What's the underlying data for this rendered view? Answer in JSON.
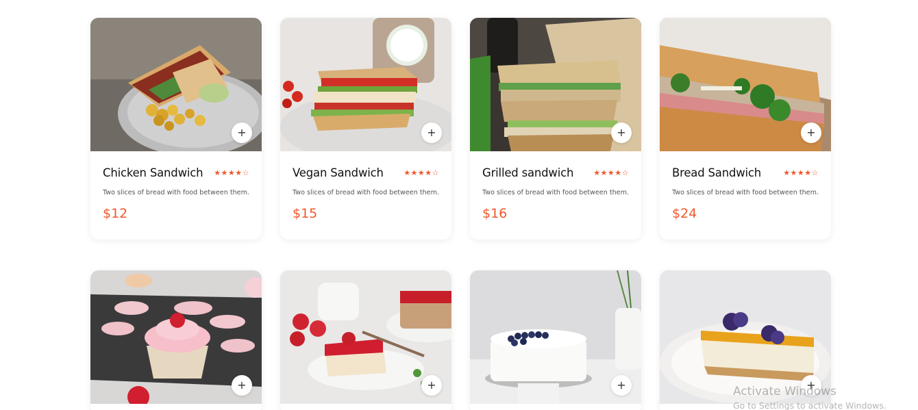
{
  "products_row1": [
    {
      "title": "Chicken Sandwich",
      "rating_text": "★★★★☆",
      "description": "Two slices of bread with food between them.",
      "price": "$12",
      "add_label": "+",
      "image": "chicken-sandwich-photo"
    },
    {
      "title": "Vegan Sandwich",
      "rating_text": "★★★★☆",
      "description": "Two slices of bread with food between them.",
      "price": "$15",
      "add_label": "+",
      "image": "vegan-sandwich-photo"
    },
    {
      "title": "Grilled sandwich",
      "rating_text": "★★★★☆",
      "description": "Two slices of bread with food between them.",
      "price": "$16",
      "add_label": "+",
      "image": "grilled-sandwich-photo"
    },
    {
      "title": "Bread Sandwich",
      "rating_text": "★★★★☆",
      "description": "Two slices of bread with food between them.",
      "price": "$24",
      "add_label": "+",
      "image": "bread-sandwich-photo"
    }
  ],
  "products_row2": [
    {
      "add_label": "+",
      "image": "cupcake-photo"
    },
    {
      "add_label": "+",
      "image": "strawberry-cake-photo"
    },
    {
      "add_label": "+",
      "image": "blueberry-cake-photo"
    },
    {
      "add_label": "+",
      "image": "cheesecake-photo"
    }
  ],
  "watermark": {
    "line1": "Activate Windows",
    "line2": "Go to Settings to activate Windows."
  },
  "colors": {
    "accent": "#f0572b",
    "text": "#111111",
    "muted": "#555555"
  }
}
